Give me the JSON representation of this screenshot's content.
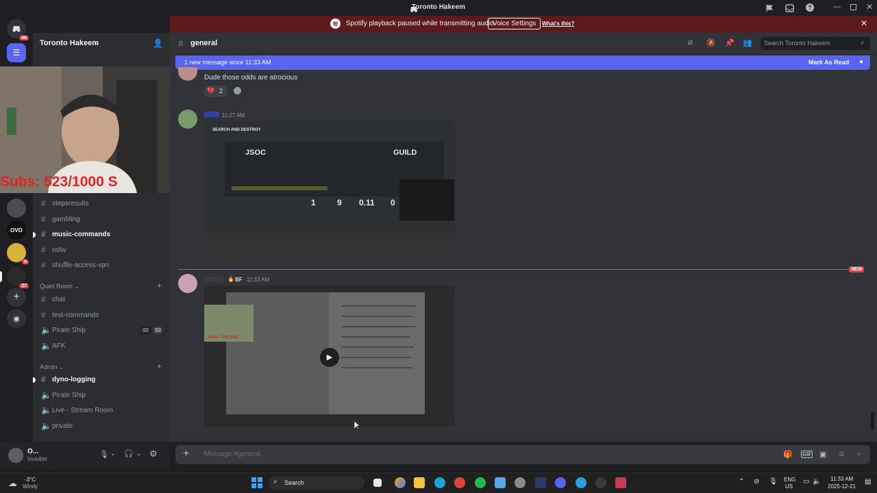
{
  "app": {
    "title": "Toronto Hakeem"
  },
  "spotify_bar": {
    "message": "Spotify playback paused while transmitting audio.",
    "voice_settings": "Voice Settings",
    "whats_this": "What's this?"
  },
  "server": {
    "name": "Toronto Hakeem"
  },
  "rail": {
    "home_badge": "66",
    "badge_6": "6",
    "badge_27": "27"
  },
  "webcam": {
    "overlay_text": "Subs: 523/1000  S"
  },
  "channels": {
    "text_top": [
      "stepsresults",
      "gambling",
      "music-commands",
      "nsfw",
      "shuffle-access-vpn"
    ],
    "quiet_room_label": "Quiet Room",
    "quiet_room": [
      "chat",
      "test-commands",
      "Pirate Ship",
      "AFK"
    ],
    "pirate_ship_counts": [
      "00",
      "99"
    ],
    "admin_label": "Admin",
    "admin": [
      "dyno-logging",
      "Pirate Ship",
      "Live - Stream Room",
      "private"
    ]
  },
  "user": {
    "name": "O...",
    "status": "Invisible"
  },
  "channel_header": {
    "name": "general",
    "search_placeholder": "Search Toronto Hakeem"
  },
  "banner": {
    "text": "1 new message since 11:33 AM",
    "mark_read": "Mark As Read"
  },
  "messages": [
    {
      "text": "Dude those odds are atrocious",
      "reaction_count": "2"
    },
    {
      "time": "11:27 AM",
      "embed": {
        "mode": "SEARCH AND DESTROY",
        "team1": "JSOC",
        "team2": "GUILD",
        "stats": [
          "1",
          "9",
          "0.11",
          "0"
        ]
      }
    },
    {
      "tag": "BF",
      "time": "11:33 AM",
      "video_overlay": "Subs: 523/1000"
    }
  ],
  "new_divider": "NEW",
  "composer": {
    "placeholder": "Message #general"
  },
  "taskbar": {
    "weather_temp": "-3°C",
    "weather_desc": "Windy",
    "search": "Search",
    "lang1": "ENG",
    "lang2": "US",
    "time": "11:33 AM",
    "date": "2025-12-21"
  },
  "colors": {
    "accent": "#5865f2",
    "spotify_bar": "#5e1a1a",
    "new_divider": "#f23f43"
  }
}
